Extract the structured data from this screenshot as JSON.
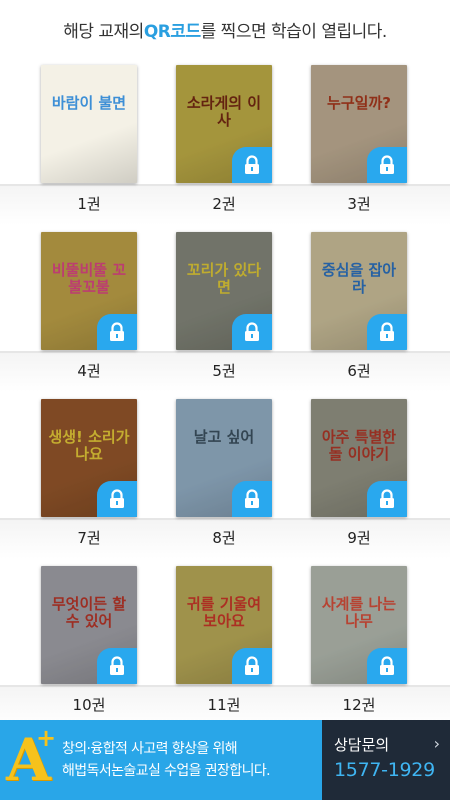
{
  "header": {
    "before": "해당 교재의 ",
    "qr": "QR코드",
    "after": "를 찍으면 학습이 열립니다."
  },
  "books": [
    {
      "label": "1권",
      "title": "바람이 불면",
      "locked": false,
      "bg": "#f4f1e6",
      "fg": "#3d8fd6"
    },
    {
      "label": "2권",
      "title": "소라게의 이사",
      "locked": true,
      "bg": "#c9b64a",
      "fg": "#7a2b14"
    },
    {
      "label": "3권",
      "title": "누구일까?",
      "locked": true,
      "bg": "#c8b59a",
      "fg": "#b03b1f"
    },
    {
      "label": "4권",
      "title": "비뚤비뚤 꼬불꼬불",
      "locked": true,
      "bg": "#c7a94b",
      "fg": "#e64b8a"
    },
    {
      "label": "5권",
      "title": "꼬리가 있다면",
      "locked": true,
      "bg": "#8a8d80",
      "fg": "#e9d23a"
    },
    {
      "label": "6권",
      "title": "중심을 잡아라",
      "locked": true,
      "bg": "#d6c9a2",
      "fg": "#2f77c7"
    },
    {
      "label": "7권",
      "title": "생생! 소리가 나요",
      "locked": true,
      "bg": "#9b5a2c",
      "fg": "#f0d33b"
    },
    {
      "label": "8권",
      "title": "날고 싶어",
      "locked": true,
      "bg": "#9ab7cf",
      "fg": "#3f5564"
    },
    {
      "label": "9권",
      "title": "아주 특별한 돌 이야기",
      "locked": true,
      "bg": "#9a9a8a",
      "fg": "#b83a2a"
    },
    {
      "label": "10권",
      "title": "무엇이든 할 수 있어",
      "locked": true,
      "bg": "#a9a9b0",
      "fg": "#c0392b"
    },
    {
      "label": "11권",
      "title": "귀를 기울여 보아요",
      "locked": true,
      "bg": "#c3b35c",
      "fg": "#d23a2b"
    },
    {
      "label": "12권",
      "title": "사계를 나는 나무",
      "locked": true,
      "bg": "#bcc3b8",
      "fg": "#e0523e"
    }
  ],
  "lock_icon": "padlock-icon",
  "banner": {
    "logo_letter": "A",
    "logo_plus": "+",
    "line1": "창의·융합적 사고력 향상을 위해",
    "line2": "해법독서논술교실 수업을 권장합니다.",
    "cs_label": "상담문의",
    "cs_phone": "1577-1929",
    "chevron": "›"
  },
  "colors": {
    "accent": "#2a9fe0",
    "lock": "#29a8ee",
    "banner_left": "#29a6e8",
    "banner_right": "#1f2a38"
  }
}
